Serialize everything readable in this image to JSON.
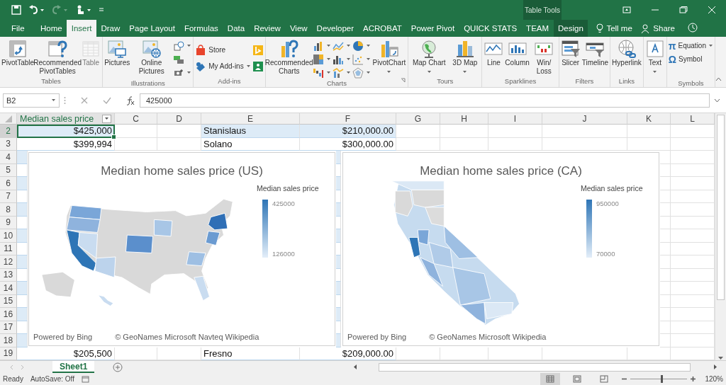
{
  "title_bar": {
    "quick_access": [
      {
        "kind": "save",
        "dropdown": false,
        "disabled": false
      },
      {
        "kind": "undo",
        "dropdown": true,
        "disabled": false
      },
      {
        "kind": "redo",
        "dropdown": true,
        "disabled": true
      },
      {
        "kind": "touch",
        "dropdown": true,
        "disabled": false
      },
      {
        "kind": "customize",
        "dropdown": false,
        "disabled": false
      }
    ],
    "context_label": "Table Tools"
  },
  "menu_tabs": [
    {
      "label": "File",
      "selected": false,
      "kind": "normal"
    },
    {
      "label": "Home",
      "selected": false,
      "kind": "normal"
    },
    {
      "label": "Insert",
      "selected": true,
      "kind": "normal"
    },
    {
      "label": "Draw",
      "selected": false,
      "kind": "normal"
    },
    {
      "label": "Page Layout",
      "selected": false,
      "kind": "normal"
    },
    {
      "label": "Formulas",
      "selected": false,
      "kind": "normal"
    },
    {
      "label": "Data",
      "selected": false,
      "kind": "normal"
    },
    {
      "label": "Review",
      "selected": false,
      "kind": "normal"
    },
    {
      "label": "View",
      "selected": false,
      "kind": "normal"
    },
    {
      "label": "Developer",
      "selected": false,
      "kind": "normal"
    },
    {
      "label": "ACROBAT",
      "selected": false,
      "kind": "normal"
    },
    {
      "label": "Power Pivot",
      "selected": false,
      "kind": "normal"
    },
    {
      "label": "QUICK STATS",
      "selected": false,
      "kind": "normal"
    },
    {
      "label": "TEAM",
      "selected": false,
      "kind": "normal"
    },
    {
      "label": "Design",
      "selected": false,
      "kind": "context"
    }
  ],
  "tell_me": "Tell me",
  "share": "Share",
  "ribbon_groups": [
    {
      "label": "Tables",
      "items": [
        {
          "kind": "large",
          "label": "PivotTable",
          "dropdown": false,
          "disabled": false
        },
        {
          "kind": "large",
          "label": "Recommended PivotTables",
          "dropdown": false,
          "disabled": false
        },
        {
          "kind": "large",
          "label": "Table",
          "dropdown": false,
          "disabled": true
        }
      ]
    },
    {
      "label": "Illustrations",
      "items": [
        {
          "kind": "large",
          "label": "Pictures",
          "dropdown": false,
          "disabled": false
        },
        {
          "kind": "large",
          "label": "Online Pictures",
          "dropdown": false,
          "disabled": false
        },
        {
          "kind": "icon",
          "dropdown": true,
          "disabled": false
        },
        {
          "kind": "icon",
          "dropdown": false,
          "disabled": false
        },
        {
          "kind": "icon",
          "dropdown": true,
          "disabled": false
        }
      ]
    },
    {
      "label": "Add-ins",
      "items": [
        {
          "kind": "small",
          "label": "Store",
          "dropdown": false,
          "disabled": false
        },
        {
          "kind": "small",
          "label": "My Add-ins",
          "dropdown": true,
          "disabled": false
        },
        {
          "kind": "icon",
          "dropdown": false,
          "disabled": false
        },
        {
          "kind": "icon",
          "dropdown": false,
          "disabled": false
        }
      ]
    },
    {
      "label": "Charts",
      "launcher": true,
      "items": [
        {
          "kind": "large",
          "label": "Recommended Charts",
          "dropdown": false,
          "disabled": false
        },
        {
          "kind": "icon",
          "dropdown": true,
          "disabled": false
        },
        {
          "kind": "icon",
          "dropdown": true,
          "disabled": false
        },
        {
          "kind": "icon",
          "dropdown": true,
          "disabled": false
        },
        {
          "kind": "icon",
          "dropdown": true,
          "disabled": false
        },
        {
          "kind": "icon",
          "dropdown": true,
          "disabled": false
        },
        {
          "kind": "icon",
          "dropdown": true,
          "disabled": false
        },
        {
          "kind": "icon",
          "dropdown": true,
          "disabled": false
        },
        {
          "kind": "icon",
          "dropdown": true,
          "disabled": false
        },
        {
          "kind": "icon",
          "dropdown": true,
          "disabled": false
        },
        {
          "kind": "large",
          "label": "PivotChart",
          "dropdown": true,
          "disabled": false
        }
      ]
    },
    {
      "label": "Tours",
      "items": [
        {
          "kind": "large",
          "label": "Map Chart",
          "dropdown": true,
          "disabled": false
        },
        {
          "kind": "large",
          "label": "3D Map",
          "dropdown": true,
          "disabled": false
        }
      ]
    },
    {
      "label": "Sparklines",
      "items": [
        {
          "kind": "large",
          "label": "Line",
          "dropdown": false,
          "disabled": false
        },
        {
          "kind": "large",
          "label": "Column",
          "dropdown": false,
          "disabled": false
        },
        {
          "kind": "large",
          "label": "Win/Loss",
          "dropdown": false,
          "disabled": false
        }
      ]
    },
    {
      "label": "Filters",
      "items": [
        {
          "kind": "large",
          "label": "Slicer",
          "dropdown": false,
          "disabled": false
        },
        {
          "kind": "large",
          "label": "Timeline",
          "dropdown": false,
          "disabled": false
        }
      ]
    },
    {
      "label": "Links",
      "items": [
        {
          "kind": "large",
          "label": "Hyperlink",
          "dropdown": false,
          "disabled": false
        }
      ]
    },
    {
      "items": [
        {
          "kind": "large",
          "label": "Text",
          "dropdown": true,
          "disabled": false
        }
      ]
    },
    {
      "label": "Symbols",
      "items": [
        {
          "kind": "small",
          "symbol": "π",
          "label": "Equation",
          "dropdown": true,
          "disabled": false
        },
        {
          "kind": "small",
          "symbol": "Ω",
          "label": "Symbol",
          "dropdown": false,
          "disabled": false
        }
      ]
    }
  ],
  "formula_bar": {
    "name_box": "B2",
    "value": "425000"
  },
  "columns": [
    {
      "label": "Median sales price",
      "kind": "table"
    },
    {
      "label": "C",
      "kind": "letter"
    },
    {
      "label": "D",
      "kind": "letter"
    },
    {
      "label": "E",
      "kind": "letter"
    },
    {
      "label": "F",
      "kind": "letter"
    },
    {
      "label": "G",
      "kind": "letter"
    },
    {
      "label": "H",
      "kind": "letter"
    },
    {
      "label": "I",
      "kind": "letter"
    },
    {
      "label": "J",
      "kind": "letter"
    },
    {
      "label": "K",
      "kind": "letter"
    },
    {
      "label": "L",
      "kind": "letter"
    }
  ],
  "rows": [
    {
      "number": "2",
      "banded": true,
      "selected": true,
      "b": "$425,000",
      "e": "Stanislaus",
      "f": "$210,000.00"
    },
    {
      "number": "3",
      "banded": false,
      "selected": false,
      "b": "$399,994",
      "e": "Solano",
      "f": "$300,000.00"
    },
    {
      "number": "4",
      "banded": true,
      "selected": false
    },
    {
      "number": "5",
      "banded": false,
      "selected": false
    },
    {
      "number": "6",
      "banded": true,
      "selected": false
    },
    {
      "number": "7",
      "banded": false,
      "selected": false
    },
    {
      "number": "8",
      "banded": true,
      "selected": false
    },
    {
      "number": "9",
      "banded": false,
      "selected": false
    },
    {
      "number": "10",
      "banded": true,
      "selected": false
    },
    {
      "number": "11",
      "banded": false,
      "selected": false
    },
    {
      "number": "12",
      "banded": true,
      "selected": false
    },
    {
      "number": "13",
      "banded": false,
      "selected": false
    },
    {
      "number": "14",
      "banded": true,
      "selected": false
    },
    {
      "number": "15",
      "banded": false,
      "selected": false
    },
    {
      "number": "16",
      "banded": true,
      "selected": false
    },
    {
      "number": "17",
      "banded": false,
      "selected": false
    },
    {
      "number": "18",
      "banded": true,
      "selected": false
    },
    {
      "number": "19",
      "banded": false,
      "selected": false,
      "b": "$205,500",
      "e": "Fresno",
      "f": "$209,000.00"
    }
  ],
  "charts": [
    {
      "kind": "us",
      "title": "Median home sales price (US)",
      "legend": {
        "title": "Median sales price",
        "max": "425000",
        "min": "126000"
      },
      "powered_by": "Powered by Bing",
      "credits": "© GeoNames Microsoft Navteq Wikipedia"
    },
    {
      "kind": "ca",
      "title": "Median home sales price (CA)",
      "legend": {
        "title": "Median sales price",
        "max": "950000",
        "min": "70000"
      },
      "powered_by": "Powered by Bing",
      "credits": "© GeoNames Microsoft Wikipedia"
    }
  ],
  "sheet_tabs": [
    {
      "label": "Sheet1",
      "selected": true
    }
  ],
  "status_bar": {
    "status": "Ready",
    "autosave": "AutoSave: Off",
    "views": [
      {
        "kind": "normal",
        "selected": true
      },
      {
        "kind": "page-layout",
        "selected": false
      },
      {
        "kind": "page-break",
        "selected": false
      }
    ],
    "zoom": {
      "level": 0.55,
      "reading": "120%"
    }
  }
}
